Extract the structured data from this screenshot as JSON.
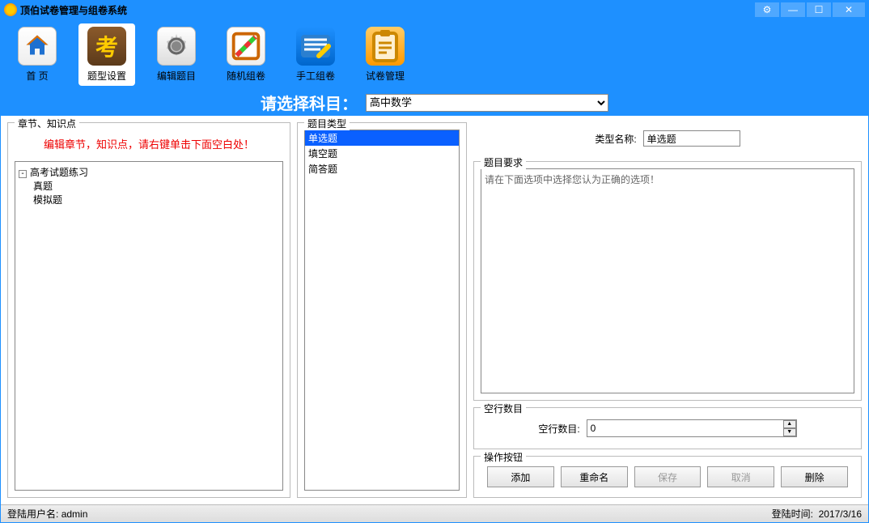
{
  "app": {
    "title": "顶伯试卷管理与组卷系统"
  },
  "toolbar": {
    "items": [
      {
        "label": "首  页",
        "icon": "home"
      },
      {
        "label": "题型设置",
        "icon": "type",
        "active": true
      },
      {
        "label": "编辑题目",
        "icon": "edit"
      },
      {
        "label": "随机组卷",
        "icon": "rand"
      },
      {
        "label": "手工组卷",
        "icon": "manual"
      },
      {
        "label": "试卷管理",
        "icon": "manage"
      }
    ]
  },
  "subject": {
    "label": "请选择科目：",
    "selected": "高中数学"
  },
  "left": {
    "legend": "章节、知识点",
    "tip": "编辑章节，知识点，请右键单击下面空白处！",
    "tree": {
      "root": "高考试题练习",
      "children": [
        "真题",
        "模拟题"
      ]
    }
  },
  "mid": {
    "legend": "题目类型",
    "items": [
      "单选题",
      "填空题",
      "简答题"
    ],
    "selectedIndex": 0
  },
  "right": {
    "nameLabel": "类型名称:",
    "nameValue": "单选题",
    "reqLegend": "题目要求",
    "reqText": "请在下面选项中选择您认为正确的选项！",
    "blankLegend": "空行数目",
    "blankLabel": "空行数目:",
    "blankValue": "0",
    "actionsLegend": "操作按钮",
    "actions": {
      "add": "添加",
      "rename": "重命名",
      "save": "保存",
      "cancel": "取消",
      "delete": "删除"
    }
  },
  "status": {
    "userLabel": "登陆用户名:",
    "userValue": "admin",
    "timeLabel": "登陆时间:",
    "timeValue": "2017/3/16"
  }
}
